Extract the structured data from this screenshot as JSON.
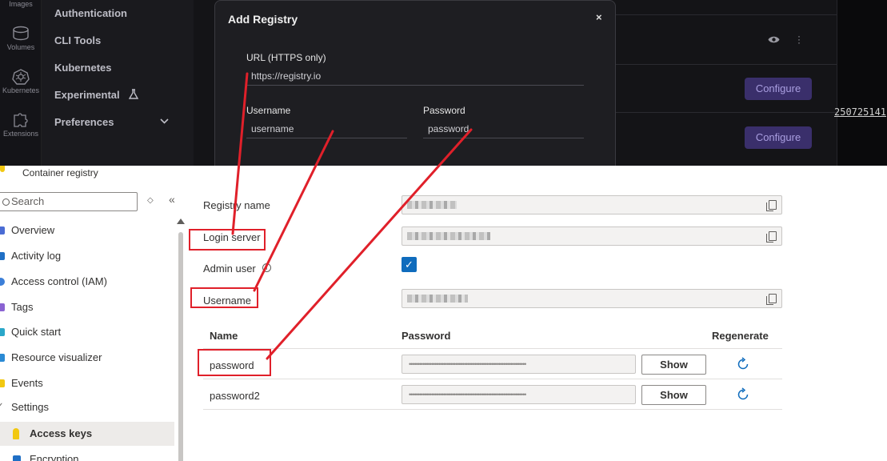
{
  "docker": {
    "rail": [
      {
        "label": "Images",
        "icon": "images-icon"
      },
      {
        "label": "Volumes",
        "icon": "volumes-icon"
      },
      {
        "label": "Kubernetes",
        "icon": "kubernetes-icon"
      },
      {
        "label": "Extensions",
        "icon": "extensions-icon"
      }
    ],
    "nav": [
      {
        "label": "Authentication"
      },
      {
        "label": "CLI Tools"
      },
      {
        "label": "Kubernetes"
      },
      {
        "label": "Experimental"
      },
      {
        "label": "Preferences"
      }
    ],
    "configure_label": "Configure",
    "right_code": "250725141"
  },
  "modal": {
    "title": "Add Registry",
    "close": "×",
    "url_label": "URL (HTTPS only)",
    "url_placeholder": "https://registry.io",
    "username_label": "Username",
    "username_placeholder": "username",
    "password_label": "Password",
    "password_placeholder": "password"
  },
  "azure": {
    "breadcrumb": "Container registry",
    "search_placeholder": "Search",
    "menu": [
      {
        "label": "Overview",
        "color": "#4a6cd4"
      },
      {
        "label": "Activity log",
        "color": "#1f6fc5"
      },
      {
        "label": "Access control (IAM)",
        "color": "#3c7fd8"
      },
      {
        "label": "Tags",
        "color": "#8a63d2"
      },
      {
        "label": "Quick start",
        "color": "#2aa7c9"
      },
      {
        "label": "Resource visualizer",
        "color": "#2a8ad4"
      },
      {
        "label": "Events",
        "color": "#f2c811"
      },
      {
        "label": "Settings",
        "color": "#605e5c"
      },
      {
        "label": "Access keys",
        "color": "#f2c811"
      },
      {
        "label": "Encryption",
        "color": "#1f6fc5"
      }
    ],
    "fields": {
      "registry_name_label": "Registry name",
      "login_server_label": "Login server",
      "admin_user_label": "Admin user",
      "username_label": "Username"
    },
    "table": {
      "col_name": "Name",
      "col_password": "Password",
      "col_regenerate": "Regenerate",
      "rows": [
        {
          "name": "password",
          "masked": "••••••••••••••••••••••••••••••••••••••••••••••••••••••••••••••••••••",
          "show": "Show"
        },
        {
          "name": "password2",
          "masked": "••••••••••••••••••••••••••••••••••••••••••••••••••••••••••••••••••••",
          "show": "Show"
        }
      ]
    }
  },
  "colors": {
    "annotation": "#e0202a",
    "accent": "#0f6cbd",
    "configure_bg": "#3a2f6b"
  }
}
